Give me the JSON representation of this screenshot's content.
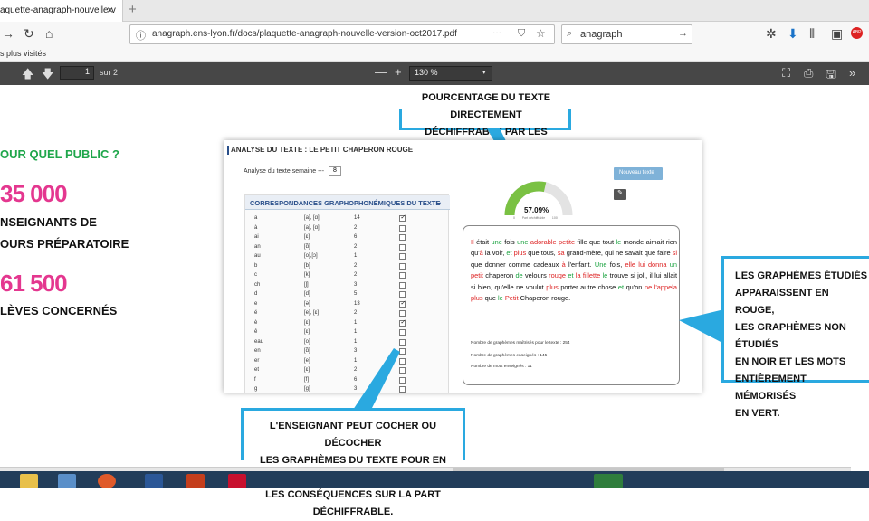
{
  "browser": {
    "tab_title": "aquette-anagraph-nouvelle-v",
    "tab_close": "×",
    "new_tab": "+",
    "url": "anagraph.ens-lyon.fr/docs/plaquette-anagraph-nouvelle-version-oct2017.pdf",
    "url_menu": "···",
    "search_value": "anagraph",
    "search_go": "→",
    "bookmarks_label": "s plus visités"
  },
  "pdf_toolbar": {
    "page_current": "1",
    "page_total": "sur 2",
    "zoom_out": "—",
    "zoom_in": "+",
    "zoom_value": "130 %"
  },
  "slide": {
    "public_heading": "OUR QUEL PUBLIC ?",
    "teachers_number": "35 000",
    "teachers_label_1": "NSEIGNANTS DE",
    "teachers_label_2": "OURS PRÉPARATOIRE",
    "students_number": "61 500",
    "students_label": "LÈVES CONCERNÉS",
    "top_callout_1": "POURCENTAGE DU TEXTE DIRECTEMENT",
    "top_callout_2": "DÉCHIFFRABLE PAR LES ÉLÈVES",
    "right_callout": [
      "LES GRAPHÈMES ÉTUDIÉS",
      "APPARAISSENT EN ROUGE,",
      "LES GRAPHÈMES NON ÉTUDIÉS",
      "EN NOIR ET LES MOTS",
      "ENTIÈREMENT MÉMORISÉS",
      "EN VERT."
    ],
    "bottom_callout": [
      "L'ENSEIGNANT PEUT COCHER OU DÉCOCHER",
      "LES GRAPHÈMES DU TEXTE POUR EN MESURER",
      "LES CONSÉQUENCES SUR LA PART DÉCHIFFRABLE."
    ]
  },
  "app": {
    "title": "ANALYSE DU TEXTE : LE PETIT CHAPERON ROUGE",
    "select_label": "Analyse du texte semaine ---",
    "select_value": "8",
    "table_title": "CORRESPONDANCES GRAPHOPHONÉMIQUES DU TEXTE",
    "table_rows": [
      {
        "g": "a",
        "p": "[a], [ɑ]",
        "n": "14",
        "checked": true
      },
      {
        "g": "à",
        "p": "[a], [ɑ]",
        "n": "2",
        "checked": false
      },
      {
        "g": "ai",
        "p": "[ɛ]",
        "n": "6",
        "checked": false
      },
      {
        "g": "an",
        "p": "[ɑ̃]",
        "n": "2",
        "checked": false
      },
      {
        "g": "au",
        "p": "[o],[ɔ]",
        "n": "1",
        "checked": false
      },
      {
        "g": "b",
        "p": "[b]",
        "n": "2",
        "checked": false
      },
      {
        "g": "c",
        "p": "[k]",
        "n": "2",
        "checked": false
      },
      {
        "g": "ch",
        "p": "[ʃ]",
        "n": "3",
        "checked": false
      },
      {
        "g": "d",
        "p": "[d]",
        "n": "5",
        "checked": false
      },
      {
        "g": "e",
        "p": "[ə]",
        "n": "13",
        "checked": true
      },
      {
        "g": "é",
        "p": "[e], [ɛ]",
        "n": "2",
        "checked": false
      },
      {
        "g": "è",
        "p": "[ɛ]",
        "n": "1",
        "checked": true
      },
      {
        "g": "ê",
        "p": "[ɛ]",
        "n": "1",
        "checked": false
      },
      {
        "g": "eau",
        "p": "[o]",
        "n": "1",
        "checked": false
      },
      {
        "g": "en",
        "p": "[ɑ̃]",
        "n": "3",
        "checked": false
      },
      {
        "g": "er",
        "p": "[e]",
        "n": "1",
        "checked": false
      },
      {
        "g": "et",
        "p": "[ɛ]",
        "n": "2",
        "checked": false
      },
      {
        "g": "f",
        "p": "[f]",
        "n": "6",
        "checked": false
      },
      {
        "g": "g",
        "p": "[g]",
        "n": "3",
        "checked": false
      }
    ],
    "btn_primary": "Nouveau texte",
    "btn_edit": "✎",
    "gauge_value": "57.09%",
    "gauge_fraction": 0.5709,
    "gauge_caption": "0        Part déchiffrable        100",
    "story_segments": [
      {
        "t": "Il ",
        "c": "r"
      },
      {
        "t": "était ",
        "c": "k"
      },
      {
        "t": "une ",
        "c": "g"
      },
      {
        "t": "fois ",
        "c": "k"
      },
      {
        "t": "une ",
        "c": "g"
      },
      {
        "t": "adorable ",
        "c": "r"
      },
      {
        "t": "petite ",
        "c": "r"
      },
      {
        "t": "fille que tout ",
        "c": "k"
      },
      {
        "t": "le ",
        "c": "g"
      },
      {
        "t": "monde aimait rien qu'",
        "c": "k"
      },
      {
        "t": "à ",
        "c": "r"
      },
      {
        "t": "la voir, ",
        "c": "k"
      },
      {
        "t": "et ",
        "c": "g"
      },
      {
        "t": "plus ",
        "c": "r"
      },
      {
        "t": "que tous, ",
        "c": "k"
      },
      {
        "t": "sa ",
        "c": "r"
      },
      {
        "t": "grand-mère, qui ne savait que faire ",
        "c": "k"
      },
      {
        "t": "si ",
        "c": "r"
      },
      {
        "t": "que donner ",
        "c": "k"
      },
      {
        "t": "comme cadeaux ",
        "c": "k"
      },
      {
        "t": "à ",
        "c": "r"
      },
      {
        "t": "l'enfant. ",
        "c": "k"
      },
      {
        "t": "Une ",
        "c": "g"
      },
      {
        "t": "fois, ",
        "c": "k"
      },
      {
        "t": "elle lui donna ",
        "c": "r"
      },
      {
        "t": "un ",
        "c": "g"
      },
      {
        "t": "petit ",
        "c": "r"
      },
      {
        "t": "chaperon ",
        "c": "k"
      },
      {
        "t": "de ",
        "c": "g"
      },
      {
        "t": "velours ",
        "c": "k"
      },
      {
        "t": "rouge ",
        "c": "r"
      },
      {
        "t": "et ",
        "c": "g"
      },
      {
        "t": "la fillette ",
        "c": "r"
      },
      {
        "t": "le ",
        "c": "g"
      },
      {
        "t": "trouve si joli, il lui allait si bien, qu'elle ne voulut ",
        "c": "k"
      },
      {
        "t": "plus ",
        "c": "r"
      },
      {
        "t": "porter autre chose ",
        "c": "k"
      },
      {
        "t": "et ",
        "c": "g"
      },
      {
        "t": "qu'on ",
        "c": "k"
      },
      {
        "t": "ne l'appela plus ",
        "c": "r"
      },
      {
        "t": "que ",
        "c": "k"
      },
      {
        "t": "le ",
        "c": "g"
      },
      {
        "t": "Petit ",
        "c": "r"
      },
      {
        "t": "Chaperon rouge.",
        "c": "k"
      }
    ],
    "stats": [
      "Nombre de graphèmes maîtrisés pour le texte : 254",
      "Nombre de graphèmes enseignés : 145",
      "Nombre de mots enseignés : 11"
    ]
  },
  "colors": {
    "accent": "#2aa9e0",
    "pink": "#e4378f",
    "green": "#1ea64a",
    "red": "#d22222"
  }
}
